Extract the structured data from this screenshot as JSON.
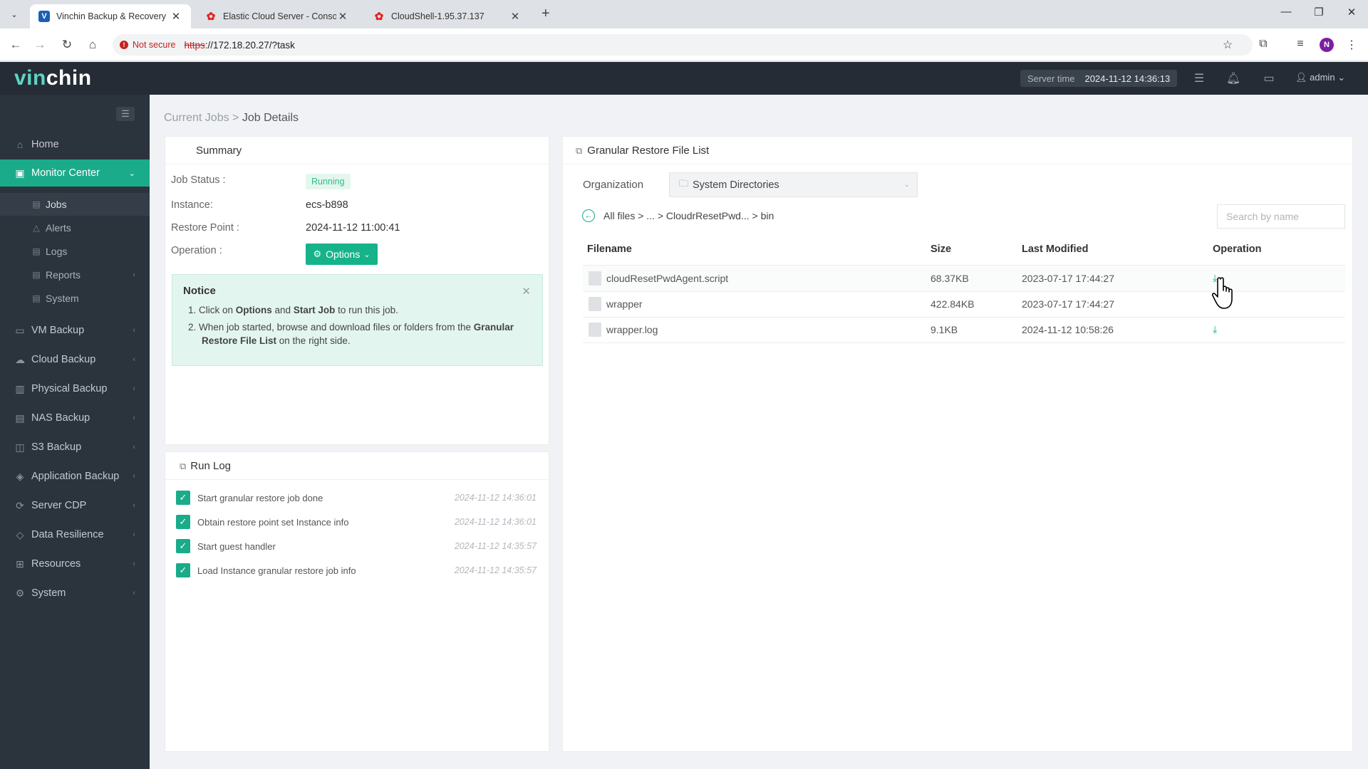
{
  "browser": {
    "tabs": [
      {
        "title": "Vinchin Backup & Recovery",
        "fav": "V",
        "fav_color": "#1a5fb4"
      },
      {
        "title": "Elastic Cloud Server - Console",
        "fav": "✿",
        "fav_color": "#e02020"
      },
      {
        "title": "CloudShell-1.95.37.137",
        "fav": "✿",
        "fav_color": "#e02020"
      }
    ],
    "security_label": "Not secure",
    "url_proto": "https",
    "url_rest": "://172.18.20.27/?task",
    "profile_initial": "N"
  },
  "header": {
    "logo_a": "vin",
    "logo_b": "chin",
    "server_time_label": "Server time",
    "server_time_value": "2024-11-12 14:36:13",
    "user": "admin"
  },
  "sidebar": {
    "items": [
      {
        "label": "Home",
        "icon": "home-icon"
      },
      {
        "label": "Monitor Center",
        "icon": "monitor-icon"
      },
      {
        "label": "VM Backup",
        "icon": "vm-icon"
      },
      {
        "label": "Cloud Backup",
        "icon": "cloud-icon"
      },
      {
        "label": "Physical Backup",
        "icon": "server-icon"
      },
      {
        "label": "NAS Backup",
        "icon": "nas-icon"
      },
      {
        "label": "S3 Backup",
        "icon": "bucket-icon"
      },
      {
        "label": "Application Backup",
        "icon": "app-icon"
      },
      {
        "label": "Server CDP",
        "icon": "cdp-icon"
      },
      {
        "label": "Data Resilience",
        "icon": "shield-icon"
      },
      {
        "label": "Resources",
        "icon": "grid-icon"
      },
      {
        "label": "System",
        "icon": "gear-icon"
      }
    ],
    "sub_items": [
      {
        "label": "Jobs"
      },
      {
        "label": "Alerts"
      },
      {
        "label": "Logs"
      },
      {
        "label": "Reports"
      },
      {
        "label": "System"
      }
    ]
  },
  "breadcrumb": {
    "parent": "Current Jobs",
    "sep": ">",
    "current": "Job Details"
  },
  "summary": {
    "title": "Summary",
    "status_label": "Job Status :",
    "status_value": "Running",
    "instance_label": "Instance:",
    "instance_value": "ecs-b898",
    "restore_label": "Restore Point :",
    "restore_value": "2024-11-12 11:00:41",
    "operation_label": "Operation :",
    "options_label": "Options"
  },
  "notice": {
    "title": "Notice",
    "line1_pre": "1. Click on ",
    "line1_b1": "Options",
    "line1_mid": " and ",
    "line1_b2": "Start Job",
    "line1_post": " to run this job.",
    "line2_pre": "2. When job started, browse and download files or folders from the ",
    "line2_b1": "Granular",
    "line2_b2": "Restore File List",
    "line2_post": " on the right side."
  },
  "runlog": {
    "title": "Run Log",
    "entries": [
      {
        "text": "Start granular restore job done",
        "time": "2024-11-12 14:36:01"
      },
      {
        "text": "Obtain restore point set Instance info",
        "time": "2024-11-12 14:36:01"
      },
      {
        "text": "Start guest handler",
        "time": "2024-11-12 14:35:57"
      },
      {
        "text": "Load Instance granular restore job info",
        "time": "2024-11-12 14:35:57"
      }
    ]
  },
  "filelist": {
    "title": "Granular Restore File List",
    "org_label": "Organization",
    "org_value": "System Directories",
    "path": "All files > ... > CloudrResetPwd... > bin",
    "search_placeholder": "Search by name",
    "columns": [
      "Filename",
      "Size",
      "Last Modified",
      "Operation"
    ],
    "rows": [
      {
        "name": "cloudResetPwdAgent.script",
        "size": "68.37KB",
        "modified": "2023-07-17 17:44:27"
      },
      {
        "name": "wrapper",
        "size": "422.84KB",
        "modified": "2023-07-17 17:44:27"
      },
      {
        "name": "wrapper.log",
        "size": "9.1KB",
        "modified": "2024-11-12 10:58:26"
      }
    ]
  }
}
